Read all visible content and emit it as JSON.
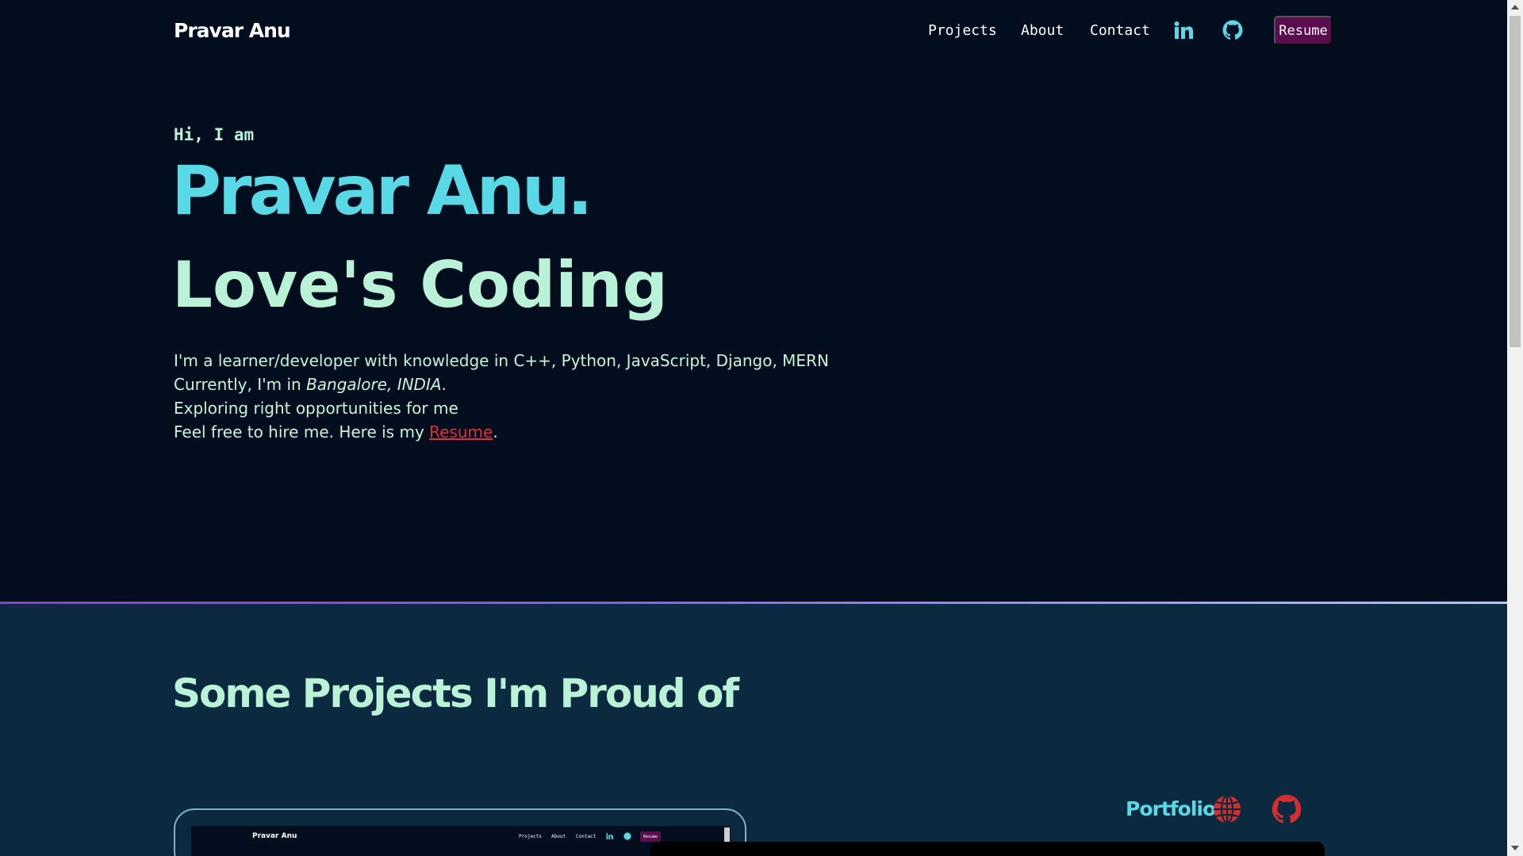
{
  "nav": {
    "brand": "Pravar Anu",
    "links": [
      "Projects",
      "About",
      "Contact"
    ],
    "icons": [
      "linkedin-icon",
      "github-icon"
    ],
    "resume_label": "Resume"
  },
  "hero": {
    "greeting": "Hi, I am",
    "name": "Pravar Anu.",
    "tagline": "Love's Coding",
    "line1": "I'm a learner/developer with knowledge in C++, Python, JavaScript, Django, MERN",
    "line2_prefix": "Currently, I'm in ",
    "line2_location": "Bangalore, INDIA",
    "line2_suffix": ".",
    "line3": "Exploring right opportunities for me",
    "line4_prefix": "Feel free to hire me. Here is my ",
    "line4_link": "Resume",
    "line4_suffix": "."
  },
  "projects": {
    "title": "Some Projects I'm Proud of",
    "items": [
      {
        "name": "Portfolio",
        "icons": [
          "globe-icon",
          "github-icon"
        ],
        "preview": {
          "brand": "Pravar Anu",
          "links": [
            "Projects",
            "About",
            "Contact"
          ],
          "resume_label": "Resume"
        }
      }
    ]
  },
  "colors": {
    "background": "#020e1e",
    "projects_background": "#0b2a40",
    "accent_cyan": "#59d9e6",
    "mint_text": "#b9f2d6",
    "resume_button": "#5a0c4e",
    "link_red": "#e0303a"
  }
}
